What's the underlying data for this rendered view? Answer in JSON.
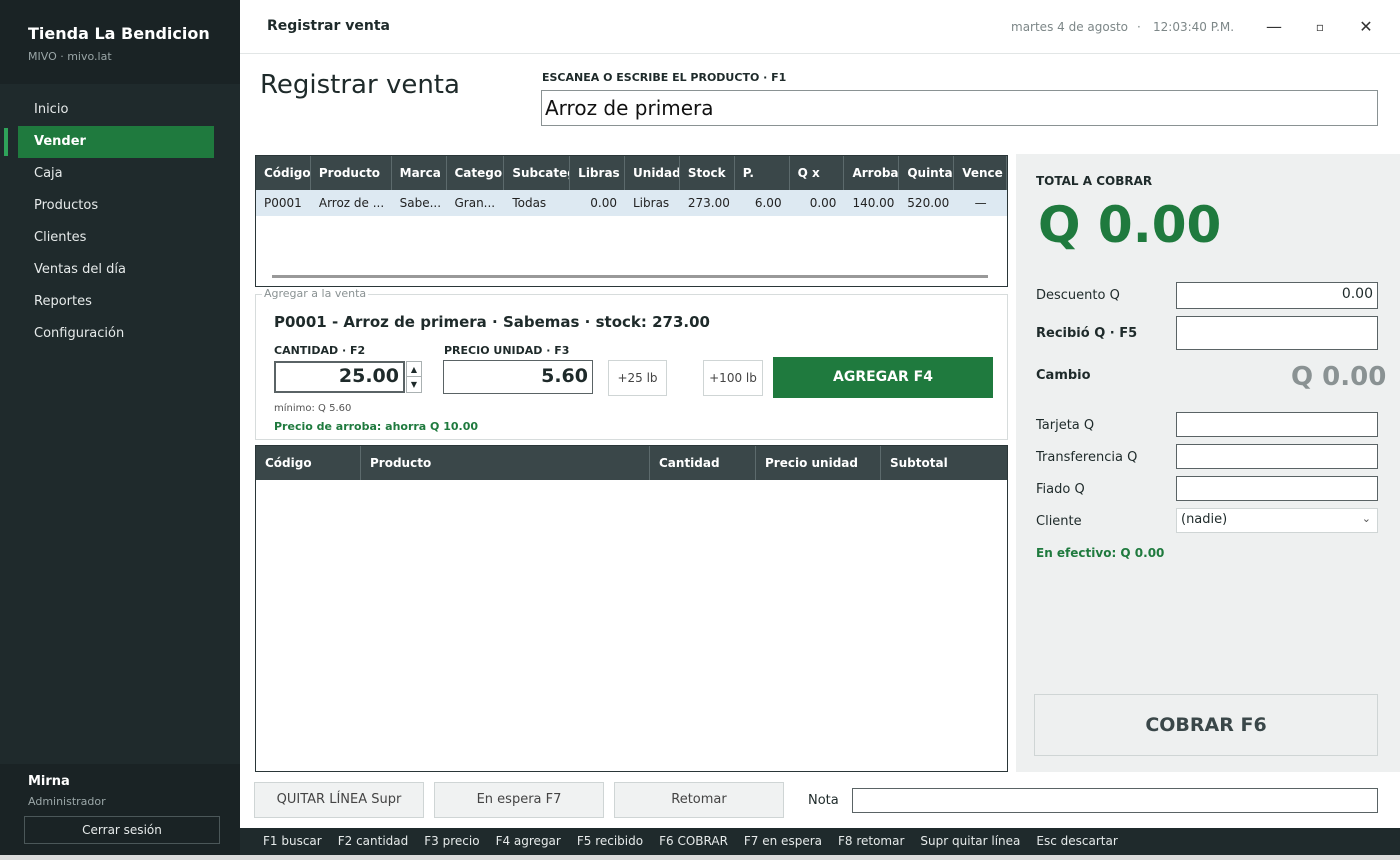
{
  "app": {
    "store_name": "Tienda La Bendicion",
    "store_sub": "MIVO · mivo.lat",
    "window_title": "Registrar venta",
    "date": "martes 4 de agosto",
    "separator": "·",
    "time": "12:03:40 P.M.",
    "window_controls": {
      "minimize": "—",
      "maximize": "▫",
      "close": "✕"
    }
  },
  "sidebar": {
    "items": [
      {
        "label": "Inicio"
      },
      {
        "label": "Vender",
        "active": true
      },
      {
        "label": "Caja"
      },
      {
        "label": "Productos"
      },
      {
        "label": "Clientes"
      },
      {
        "label": "Ventas del día"
      },
      {
        "label": "Reportes"
      },
      {
        "label": "Configuración"
      }
    ],
    "user_name": "Mirna",
    "user_role": "Administrador",
    "logout_label": "Cerrar sesión"
  },
  "main": {
    "page_title": "Registrar venta",
    "scan_label": "ESCANEA O ESCRIBE EL PRODUCTO   ·   F1",
    "scan_value": "Arroz de primera"
  },
  "product_grid": {
    "headers": [
      "Código",
      "Producto",
      "Marca",
      "Categor",
      "Subcateg",
      "Libras",
      "Unidad",
      "Stock",
      "P.",
      "Q x",
      "Arroba",
      "Quintal",
      "Vence"
    ],
    "rows": [
      [
        "P0001",
        "Arroz de ...",
        "Sabe...",
        "Gran...",
        "Todas",
        "0.00",
        "Libras",
        "273.00",
        "6.00",
        "0.00",
        "140.00",
        "520.00",
        "—"
      ]
    ]
  },
  "add_box": {
    "legend": "Agregar a la venta",
    "product_line": "P0001  -  Arroz de primera   ·   Sabemas    ·    stock: 273.00",
    "qty_label": "CANTIDAD   ·   F2",
    "qty_value": "25.00",
    "price_label": "PRECIO UNIDAD   ·   F3",
    "price_value": "5.60",
    "plus25_label": "+25 lb",
    "plus100_label": "+100 lb",
    "add_label": "AGREGAR     F4",
    "minimum_text": "mínimo: Q 5.60",
    "arroba_text": "Precio de arroba: ahorra Q 10.00"
  },
  "cart": {
    "headers": [
      "Código",
      "Producto",
      "Cantidad",
      "Precio unidad",
      "Subtotal"
    ]
  },
  "bottom": {
    "remove_label": "QUITAR LÍNEA     Supr",
    "hold_label": "En espera       F7",
    "resume_label": "Retomar",
    "note_label": "Nota",
    "note_value": ""
  },
  "statusbar": {
    "shortcuts": [
      "F1 buscar",
      "F2 cantidad",
      "F3 precio",
      "F4 agregar",
      "F5 recibido",
      "F6 COBRAR",
      "F7 en espera",
      "F8 retomar",
      "Supr quitar línea",
      "Esc descartar"
    ]
  },
  "payment": {
    "total_label": "TOTAL A COBRAR",
    "total_value": "Q 0.00",
    "discount_label": "Descuento Q",
    "discount_value": "0.00",
    "received_label": "Recibió Q    ·    F5",
    "received_value": "",
    "change_label": "Cambio",
    "change_value": "Q 0.00",
    "card_label": "Tarjeta Q",
    "transfer_label": "Transferencia Q",
    "credit_label": "Fiado Q",
    "client_label": "Cliente",
    "client_value": "(nadie)",
    "cash_text": "En efectivo: Q 0.00",
    "charge_label": "COBRAR      F6"
  },
  "colors": {
    "accent": "#1f7a3e",
    "sidebar_bg": "#1f2a2c",
    "grid_header": "#3a4749",
    "selected_row": "#dde9f2"
  }
}
